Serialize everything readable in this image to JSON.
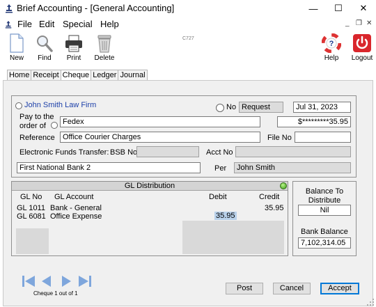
{
  "window": {
    "title": "Brief Accounting - [General Accounting]",
    "minimize": "—",
    "maximize": "☐",
    "close": "✕"
  },
  "menu": {
    "items": [
      "File",
      "Edit",
      "Special",
      "Help"
    ],
    "mdi_minimize": "_",
    "mdi_restore": "❐",
    "mdi_close": "✕"
  },
  "toolbar": {
    "new": "New",
    "find": "Find",
    "print": "Print",
    "delete": "Delete",
    "code": "C727",
    "help": "Help",
    "logout": "Logout"
  },
  "tabs": [
    "Home",
    "Receipt",
    "Cheque",
    "Ledger",
    "Journal"
  ],
  "active_tab": "Cheque",
  "cheque": {
    "payee_option": "John Smith Law Firm",
    "no_label": "No",
    "request_value": "Request",
    "date": "Jul 31, 2023",
    "pay_to_label_1": "Pay to the",
    "pay_to_label_2": "order of",
    "pay_to_value": "Fedex",
    "amount": "$*********35.95",
    "reference_label": "Reference",
    "reference_value": "Office Courier Charges",
    "file_no_label": "File No",
    "file_no_value": "",
    "eft_label": "Electronic Funds Transfer:",
    "bsb_label": "BSB No",
    "bsb_value": "",
    "acct_label": "Acct No",
    "acct_value": "",
    "bank": "First National Bank 2",
    "per_label": "Per",
    "per_value": "John Smith"
  },
  "gl": {
    "title": "GL Distribution",
    "headers": {
      "gl_no": "GL No",
      "account": "GL Account",
      "debit": "Debit",
      "credit": "Credit"
    },
    "rows": [
      {
        "gl_no": "GL 1011",
        "account": "Bank - General",
        "debit": "",
        "credit": "35.95"
      },
      {
        "gl_no": "GL 6081",
        "account": "Office Expense",
        "debit": "35.95",
        "credit": ""
      }
    ]
  },
  "balance": {
    "label_1": "Balance To",
    "label_2": "Distribute",
    "value": "Nil",
    "bank_label": "Bank Balance",
    "bank_value": "7,102,314.05"
  },
  "footer": {
    "record_status": "Cheque 1 out of 1",
    "post": "Post",
    "cancel": "Cancel",
    "accept": "Accept"
  },
  "colors": {
    "accent": "#0078d7",
    "link_blue": "#1c3fa8",
    "nav_arrow": "#7ea6dc",
    "logout_red": "#d9262c"
  }
}
